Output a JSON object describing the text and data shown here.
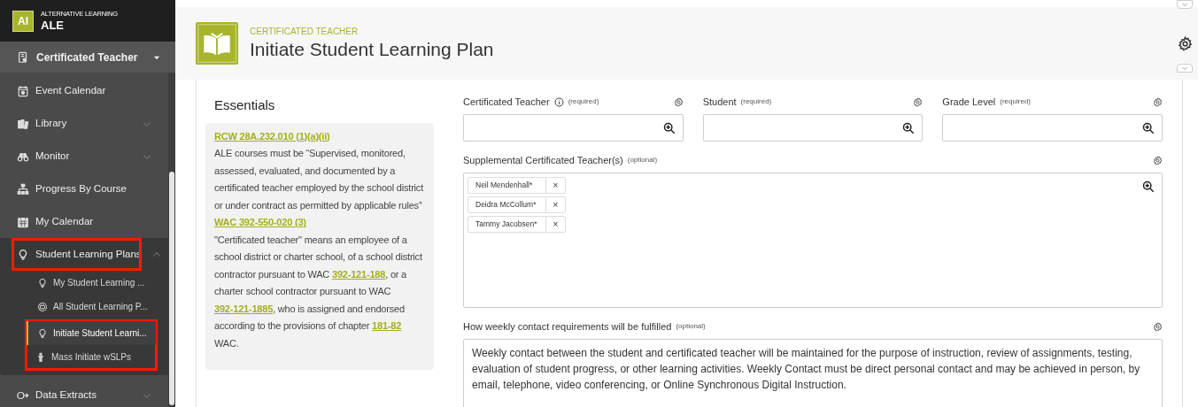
{
  "brand": {
    "logo": "AI",
    "subtitle": "ALTERNATIVE LEARNING",
    "title": "ALE"
  },
  "role_menu": {
    "label": "Certificated Teacher"
  },
  "nav": [
    {
      "label": "Event Calendar",
      "expandable": false,
      "expanded": false,
      "highlighted": false
    },
    {
      "label": "Library",
      "expandable": true,
      "expanded": false,
      "highlighted": false
    },
    {
      "label": "Monitor",
      "expandable": true,
      "expanded": false,
      "highlighted": false
    },
    {
      "label": "Progress By Course",
      "expandable": false,
      "expanded": false,
      "highlighted": false
    },
    {
      "label": "My Calendar",
      "expandable": false,
      "expanded": false,
      "highlighted": false
    },
    {
      "label": "Student Learning Plans",
      "expandable": true,
      "expanded": true,
      "highlighted": true,
      "children": [
        {
          "label": "My Student Learning ...",
          "selected": false,
          "highlighted": false
        },
        {
          "label": "All Student Learning P...",
          "selected": false,
          "highlighted": false
        },
        {
          "label": "Initiate Student Learni...",
          "selected": true,
          "highlighted": true
        },
        {
          "label": "Mass Initiate wSLPs",
          "selected": false,
          "highlighted": true
        }
      ]
    },
    {
      "label": "Data Extracts",
      "expandable": true,
      "expanded": false,
      "highlighted": false
    }
  ],
  "header": {
    "eyebrow": "CERTIFICATED TEACHER",
    "title": "Initiate Student Learning Plan"
  },
  "essentials": {
    "title": "Essentials",
    "blocks": [
      {
        "kind": "link",
        "segments": [
          {
            "text": "RCW 28A.232.010 (1)(a)(ii)",
            "link": true
          }
        ]
      },
      {
        "kind": "text",
        "segments": [
          {
            "text": "ALE courses must be “Supervised, monitored, assessed, evaluated, and documented by a certificated teacher employed by the school district or under contract as permitted by applicable rules”",
            "link": false
          }
        ]
      },
      {
        "kind": "link",
        "segments": [
          {
            "text": "WAC 392-550-020 (3)",
            "link": true
          }
        ]
      },
      {
        "kind": "text",
        "segments": [
          {
            "text": "\"Certificated teacher\" means an employee of a school district or charter school, of a school district contractor pursuant to WAC ",
            "link": false
          },
          {
            "text": "392-121-188",
            "link": true
          },
          {
            "text": ", or a charter school contractor pursuant to WAC ",
            "link": false
          },
          {
            "text": "392-121-1885",
            "link": true
          },
          {
            "text": ", who is assigned and endorsed according to the provisions of chapter ",
            "link": false
          },
          {
            "text": "181-82",
            "link": true
          },
          {
            "text": " WAC.",
            "link": false
          }
        ]
      }
    ]
  },
  "fields": [
    {
      "kind": "lookup",
      "label": "Certificated Teacher",
      "info": true,
      "note": "(required)"
    },
    {
      "kind": "lookup",
      "label": "Student",
      "info": false,
      "note": "(required)"
    },
    {
      "kind": "lookup",
      "label": "Grade Level",
      "info": false,
      "note": "(required)"
    },
    {
      "kind": "multi",
      "label": "Supplemental Certificated Teacher(s)",
      "info": false,
      "note": "(optional)",
      "tokens": [
        "Neil Mendenhall*",
        "Deidra McCollum*",
        "Tammy Jacobsen*"
      ],
      "remove": "×"
    },
    {
      "kind": "text",
      "label": "How weekly contact requirements will be fulfilled",
      "info": false,
      "note": "(optional)",
      "value": "Weekly contact between the student and certificated teacher will be maintained for the purpose of instruction, review of assignments, testing, evaluation of student progress, or other learning activities. Weekly Contact must be direct personal contact and may be achieved in person, by email, telephone, video conferencing, or Online Synchronous Digital Instruction."
    }
  ]
}
